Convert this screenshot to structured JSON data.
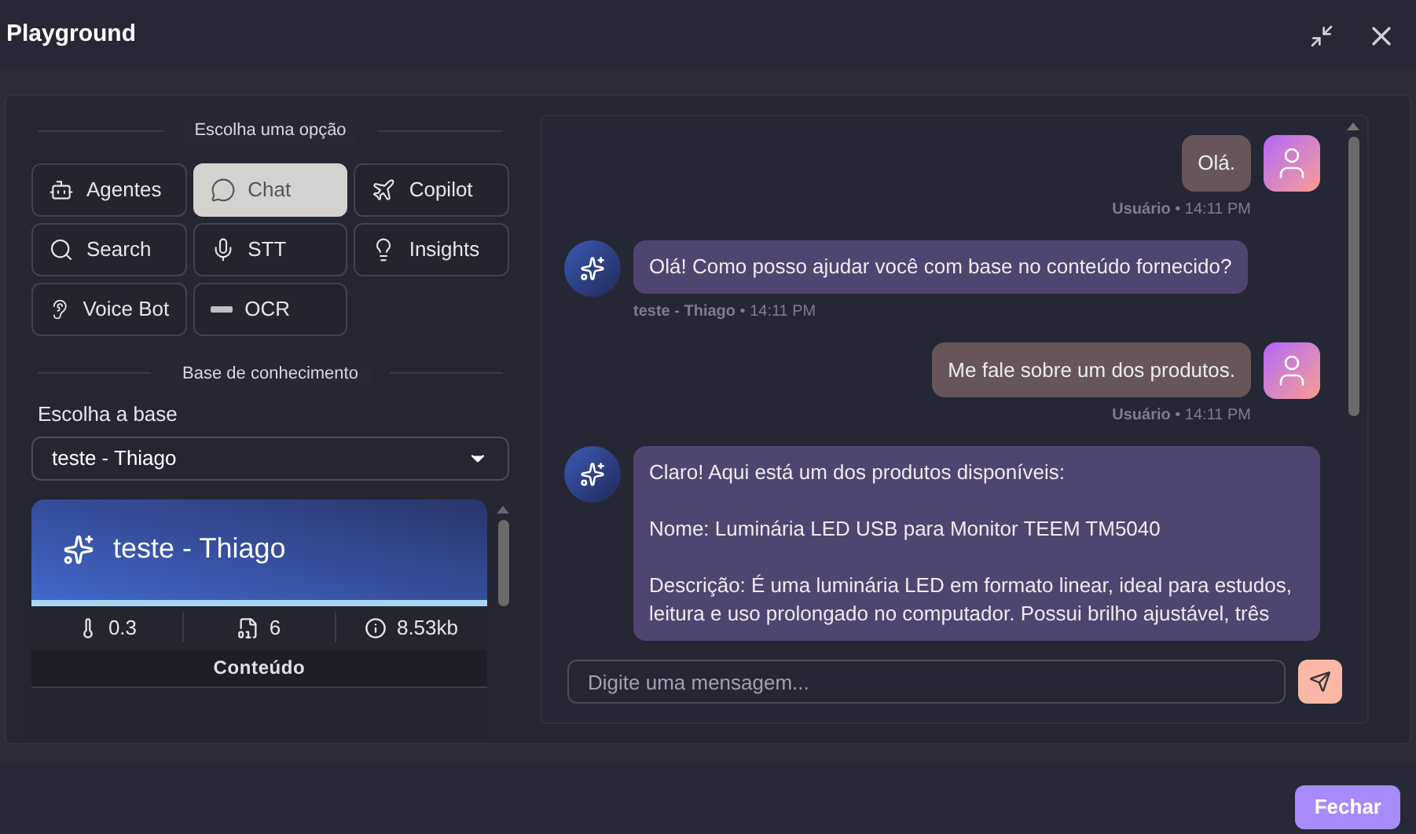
{
  "window": {
    "title": "Playground"
  },
  "options": {
    "heading": "Escolha uma opção",
    "items": [
      {
        "label": "Agentes",
        "selected": false
      },
      {
        "label": "Chat",
        "selected": true
      },
      {
        "label": "Copilot",
        "selected": false
      },
      {
        "label": "Search",
        "selected": false
      },
      {
        "label": "STT",
        "selected": false
      },
      {
        "label": "Insights",
        "selected": false
      },
      {
        "label": "Voice Bot",
        "selected": false
      },
      {
        "label": "OCR",
        "selected": false
      }
    ]
  },
  "knowledge": {
    "heading": "Base de conhecimento",
    "select_label": "Escolha a base",
    "select_value": "teste - Thiago",
    "card": {
      "title": "teste - Thiago",
      "stats": [
        "0.3",
        "6",
        "8.53kb"
      ],
      "section": "Conteúdo"
    }
  },
  "chat": {
    "messages": [
      {
        "kind": "user",
        "paragraphs": [
          "Olá."
        ],
        "meta": "**Usuário** • 14:11 PM"
      },
      {
        "kind": "bot",
        "paragraphs": [
          "Olá! Como posso ajudar você com base no conteúdo fornecido?"
        ],
        "meta": "**teste - Thiago** • 14:11 PM"
      },
      {
        "kind": "user",
        "paragraphs": [
          "Me fale sobre um dos produtos."
        ],
        "meta": "**Usuário** • 14:11 PM"
      },
      {
        "kind": "bot",
        "paragraphs": [
          "Claro! Aqui está um dos produtos disponíveis:",
          "Nome: Luminária LED USB para Monitor TEEM TM5040",
          "Descrição: É uma luminária LED em formato linear, ideal para estudos, leitura e uso prolongado no computador. Possui brilho ajustável, três"
        ]
      }
    ],
    "input": {
      "placeholder": "Digite uma mensagem..."
    }
  },
  "footer": {
    "button": "Fechar"
  }
}
